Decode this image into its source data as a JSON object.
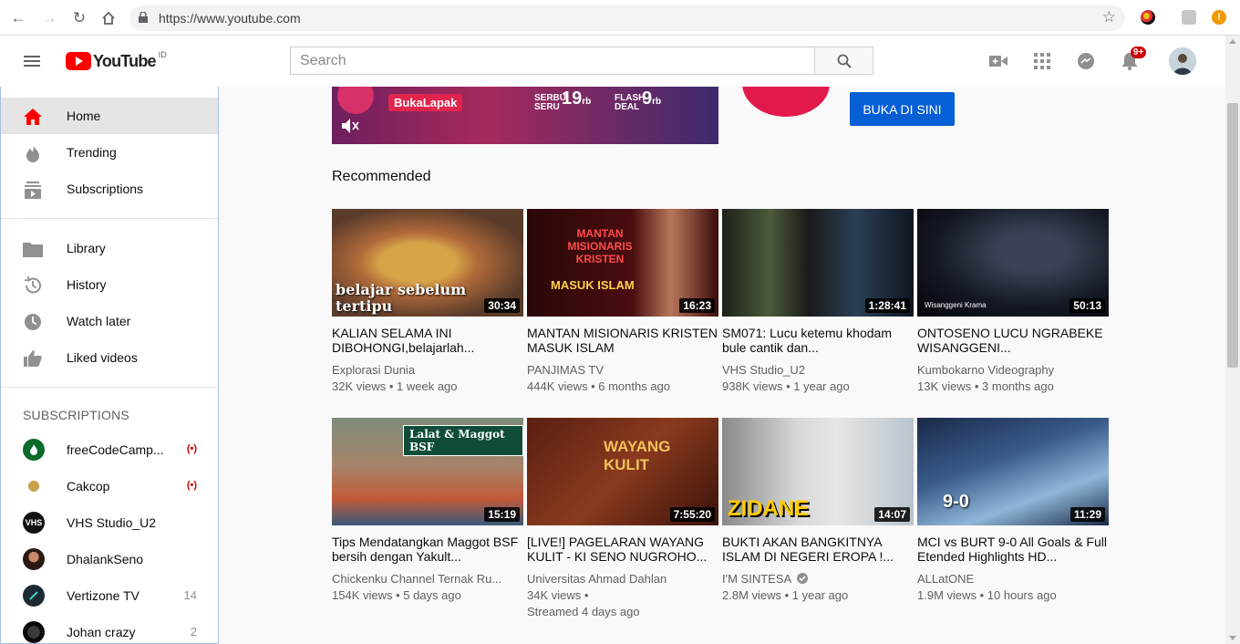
{
  "browser": {
    "url": "https://www.youtube.com"
  },
  "header": {
    "logo_text": "YouTube",
    "logo_country": "ID",
    "search_placeholder": "Search",
    "notification_count": "9+"
  },
  "sidebar": {
    "main_items": [
      {
        "label": "Home",
        "icon": "home-icon"
      },
      {
        "label": "Trending",
        "icon": "flame-icon"
      },
      {
        "label": "Subscriptions",
        "icon": "subscriptions-icon"
      }
    ],
    "library_items": [
      {
        "label": "Library",
        "icon": "folder-icon"
      },
      {
        "label": "History",
        "icon": "history-icon"
      },
      {
        "label": "Watch later",
        "icon": "clock-icon"
      },
      {
        "label": "Liked videos",
        "icon": "thumbs-up-icon"
      }
    ],
    "subscriptions_heading": "SUBSCRIPTIONS",
    "subscriptions": [
      {
        "name": "freeCodeCamp...",
        "status": "live"
      },
      {
        "name": "Cakcop",
        "status": "live"
      },
      {
        "name": "VHS Studio_U2",
        "status": ""
      },
      {
        "name": "DhalankSeno",
        "status": ""
      },
      {
        "name": "Vertizone TV",
        "status": "14"
      },
      {
        "name": "Johan crazy",
        "status": "2"
      }
    ]
  },
  "ad": {
    "brand": "BukaLapak",
    "promo1_small": "SERBU SERU",
    "promo1_big": "19",
    "promo1_unit": "rb",
    "promo2_small": "FLASH DEAL",
    "promo2_big": "9",
    "promo2_unit": "rb",
    "cta": "BUKA DI SINI"
  },
  "main": {
    "section_title": "Recommended",
    "videos": [
      {
        "title": "KALIAN SELAMA INI DIBOHONGI,belajarlah...",
        "channel": "Explorasi Dunia",
        "meta": "32K views • 1 week ago",
        "duration": "30:34",
        "thumb_text": "belajar sebelum tertipu"
      },
      {
        "title": "MANTAN MISIONARIS KRISTEN MASUK ISLAM",
        "channel": "PANJIMAS TV",
        "meta": "444K views • 6 months ago",
        "duration": "16:23",
        "thumb_text": "MASUK ISLAM"
      },
      {
        "title": "SM071: Lucu ketemu khodam bule cantik dan...",
        "channel": "VHS Studio_U2",
        "meta": "938K views • 1 year ago",
        "duration": "1:28:41",
        "thumb_text": ""
      },
      {
        "title": "ONTOSENO LUCU NGRABEKE WISANGGENI...",
        "channel": "Kumbokarno Videography",
        "meta": "13K views • 3 months ago",
        "duration": "50:13",
        "thumb_text": "Wisanggeni Krama"
      },
      {
        "title": "Tips Mendatangkan Maggot BSF bersih dengan Yakult...",
        "channel": "Chickenku Channel Ternak Ru...",
        "meta": "154K views • 5 days ago",
        "duration": "15:19",
        "thumb_text": "Lalat & Maggot BSF"
      },
      {
        "title": "[LIVE!] PAGELARAN WAYANG KULIT - KI SENO NUGROHO...",
        "channel": "Universitas Ahmad Dahlan",
        "meta": "34K views •",
        "meta2": "Streamed 4 days ago",
        "duration": "7:55:20",
        "thumb_text": "WAYANG KULIT"
      },
      {
        "title": "BUKTI AKAN BANGKITNYA ISLAM DI NEGERI EROPA !...",
        "channel": "I'M SINTESA",
        "meta": "2.8M views • 1 year ago",
        "duration": "14:07",
        "thumb_text": "ZIDANE",
        "verified": true
      },
      {
        "title": "MCI vs BURT 9-0 All Goals & Full Etended Highlights HD...",
        "channel": "ALLatONE",
        "meta": "1.9M views • 10 hours ago",
        "duration": "11:29",
        "thumb_text": "9-0"
      }
    ]
  }
}
